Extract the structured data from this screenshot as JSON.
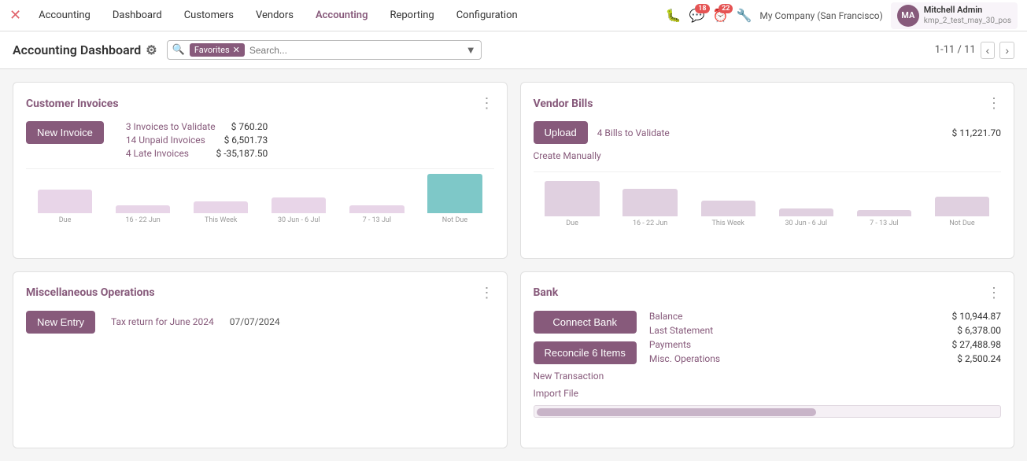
{
  "nav": {
    "logo": "✕",
    "items": [
      "Accounting",
      "Dashboard",
      "Customers",
      "Vendors",
      "Accounting",
      "Reporting",
      "Configuration"
    ],
    "active_index": 4,
    "icons": {
      "bug": "🐛",
      "message_badge": "18",
      "clock_badge": "22",
      "wrench": "🔧"
    },
    "company": "My Company (San Francisco)",
    "user": {
      "name": "Mitchell Admin",
      "subtitle": "kmp_2_test_may_30_pos",
      "initials": "MA"
    }
  },
  "subheader": {
    "title": "Accounting Dashboard",
    "filter_label": "Favorites",
    "search_placeholder": "Search...",
    "pagination": "1-11 / 11"
  },
  "customer_invoices": {
    "title": "Customer Invoices",
    "new_invoice_label": "New Invoice",
    "invoices_to_validate": "3 Invoices to Validate",
    "invoices_to_validate_amount": "$ 760.20",
    "unpaid_invoices": "14 Unpaid Invoices",
    "unpaid_invoices_amount": "$ 6,501.73",
    "late_invoices": "4 Late Invoices",
    "late_invoices_amount": "$ -35,187.50",
    "chart_labels": [
      "Due",
      "16 - 22 Jun",
      "This Week",
      "30 Jun - 6 Jul",
      "7 - 13 Jul",
      "Not Due"
    ],
    "chart_bars": [
      30,
      10,
      15,
      20,
      10,
      55
    ]
  },
  "vendor_bills": {
    "title": "Vendor Bills",
    "upload_label": "Upload",
    "create_manually_label": "Create Manually",
    "bills_to_validate": "4 Bills to Validate",
    "bills_to_validate_amount": "$ 11,221.70",
    "chart_labels": [
      "Due",
      "16 - 22 Jun",
      "This Week",
      "30 Jun - 6 Jul",
      "7 - 13 Jul",
      "Not Due"
    ],
    "chart_bars": [
      45,
      35,
      20,
      10,
      8,
      25
    ]
  },
  "misc_operations": {
    "title": "Miscellaneous Operations",
    "new_entry_label": "New Entry",
    "tax_return_label": "Tax return for June 2024",
    "tax_return_date": "07/07/2024"
  },
  "bank": {
    "title": "Bank",
    "connect_bank_label": "Connect Bank",
    "reconcile_label": "Reconcile 6 Items",
    "new_transaction_label": "New Transaction",
    "import_file_label": "Import File",
    "balance_label": "Balance",
    "balance_value": "$ 10,944.87",
    "last_statement_label": "Last Statement",
    "last_statement_value": "$ 6,378.00",
    "payments_label": "Payments",
    "payments_value": "$ 27,488.98",
    "misc_operations_label": "Misc. Operations",
    "misc_operations_value": "$ 2,500.24"
  }
}
